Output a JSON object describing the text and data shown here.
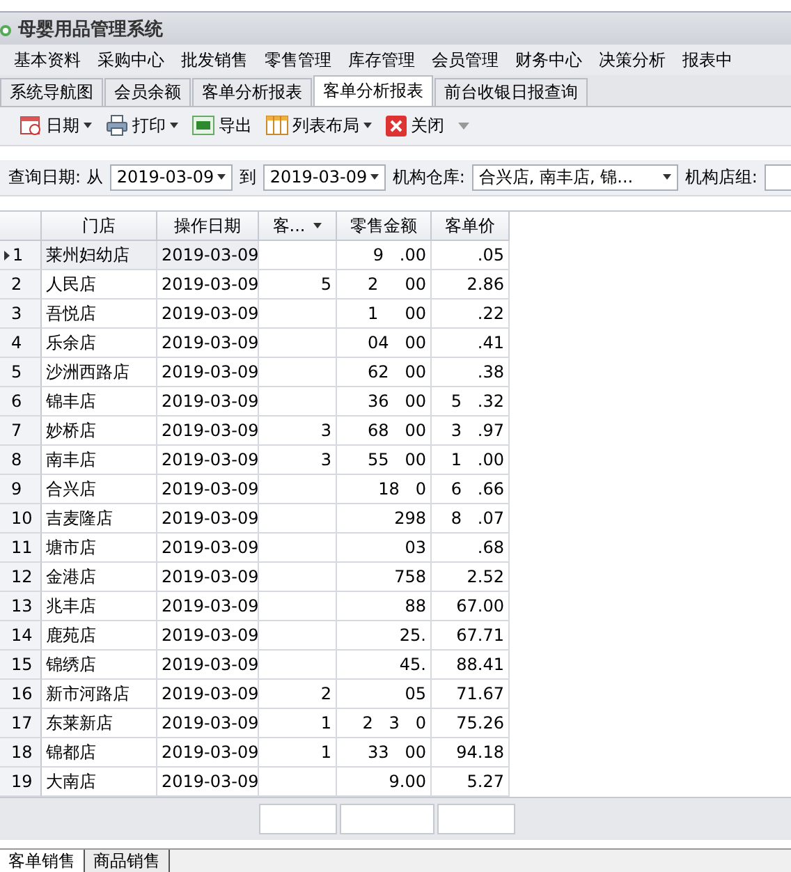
{
  "window": {
    "title": "母婴用品管理系统"
  },
  "menu": [
    "基本资料",
    "采购中心",
    "批发销售",
    "零售管理",
    "库存管理",
    "会员管理",
    "财务中心",
    "决策分析",
    "报表中"
  ],
  "tabs": [
    {
      "label": "系统导航图",
      "selected": false
    },
    {
      "label": "会员余额",
      "selected": false
    },
    {
      "label": "客单分析报表",
      "selected": false
    },
    {
      "label": "客单分析报表",
      "selected": true
    },
    {
      "label": "前台收银日报查询",
      "selected": false
    }
  ],
  "toolbar": [
    {
      "kind": "date",
      "label": "日期",
      "dropdown": true
    },
    {
      "kind": "print",
      "label": "打印",
      "dropdown": true
    },
    {
      "kind": "export",
      "label": "导出",
      "dropdown": false
    },
    {
      "kind": "layout",
      "label": "列表布局",
      "dropdown": true
    },
    {
      "kind": "close",
      "label": "关闭",
      "dropdown": false
    }
  ],
  "filters": {
    "date_label": "查询日期: 从",
    "date_from": "2019-03-09",
    "to_label": "到",
    "date_to": "2019-03-09",
    "warehouse_label": "机构仓库:",
    "warehouse": "合兴店, 南丰店, 锦...",
    "group_label": "机构店组:"
  },
  "table": {
    "columns": [
      "门店",
      "操作日期",
      "客...",
      "零售金额",
      "客单价"
    ],
    "rows": [
      {
        "no": "1",
        "store": "莱州妇幼店",
        "date": "2019-03-09",
        "count": "",
        "amount": "9   .00",
        "price": ".05",
        "selected": true
      },
      {
        "no": "2",
        "store": "人民店",
        "date": "2019-03-09",
        "count": "5",
        "amount": "2     00",
        "price": "2.86",
        "selected": false
      },
      {
        "no": "3",
        "store": "吾悦店",
        "date": "2019-03-09",
        "count": "",
        "amount": "1     00",
        "price": ".22",
        "selected": false
      },
      {
        "no": "4",
        "store": "乐余店",
        "date": "2019-03-09",
        "count": "",
        "amount": "04   00",
        "price": ".41",
        "selected": false
      },
      {
        "no": "5",
        "store": "沙洲西路店",
        "date": "2019-03-09",
        "count": "",
        "amount": "62   00",
        "price": ".38",
        "selected": false
      },
      {
        "no": "6",
        "store": "锦丰店",
        "date": "2019-03-09",
        "count": "",
        "amount": "36   00",
        "price": "5   .32",
        "selected": false
      },
      {
        "no": "7",
        "store": "妙桥店",
        "date": "2019-03-09",
        "count": "3",
        "amount": "68   00",
        "price": "3   .97",
        "selected": false
      },
      {
        "no": "8",
        "store": "南丰店",
        "date": "2019-03-09",
        "count": "3",
        "amount": "55   00",
        "price": "1   .00",
        "selected": false
      },
      {
        "no": "9",
        "store": "合兴店",
        "date": "2019-03-09",
        "count": "",
        "amount": "18   0",
        "price": "6   .66",
        "selected": false
      },
      {
        "no": "10",
        "store": "吉麦隆店",
        "date": "2019-03-09",
        "count": "",
        "amount": "298",
        "price": "8   .07",
        "selected": false
      },
      {
        "no": "11",
        "store": "塘市店",
        "date": "2019-03-09",
        "count": "",
        "amount": "03",
        "price": ".68",
        "selected": false
      },
      {
        "no": "12",
        "store": "金港店",
        "date": "2019-03-09",
        "count": "",
        "amount": "758",
        "price": "2.52",
        "selected": false
      },
      {
        "no": "13",
        "store": "兆丰店",
        "date": "2019-03-09",
        "count": "",
        "amount": "88",
        "price": "67.00",
        "selected": false
      },
      {
        "no": "14",
        "store": "鹿苑店",
        "date": "2019-03-09",
        "count": "",
        "amount": "25.",
        "price": "67.71",
        "selected": false
      },
      {
        "no": "15",
        "store": "锦绣店",
        "date": "2019-03-09",
        "count": "",
        "amount": "45.",
        "price": "88.41",
        "selected": false
      },
      {
        "no": "16",
        "store": "新市河路店",
        "date": "2019-03-09",
        "count": "2",
        "amount": "05",
        "price": "71.67",
        "selected": false
      },
      {
        "no": "17",
        "store": "东莱新店",
        "date": "2019-03-09",
        "count": "1",
        "amount": "2   3   0",
        "price": "75.26",
        "selected": false
      },
      {
        "no": "18",
        "store": "锦都店",
        "date": "2019-03-09",
        "count": "1",
        "amount": "33   00",
        "price": "94.18",
        "selected": false
      },
      {
        "no": "19",
        "store": "大南店",
        "date": "2019-03-09",
        "count": "",
        "amount": "9.00",
        "price": "5.27",
        "selected": false
      }
    ]
  },
  "bottom_tabs": [
    {
      "label": "客单销售",
      "selected": true
    },
    {
      "label": "商品销售",
      "selected": false
    }
  ]
}
